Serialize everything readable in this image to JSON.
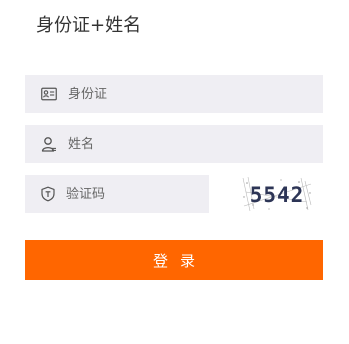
{
  "header": {
    "title": "身份证+姓名"
  },
  "form": {
    "id_field": {
      "placeholder": "身份证",
      "icon": "id-card-icon"
    },
    "name_field": {
      "placeholder": "姓名",
      "icon": "user-icon"
    },
    "code_field": {
      "placeholder": "验证码",
      "icon": "shield-icon"
    },
    "captcha": {
      "text": "5542"
    },
    "login_label": "登录"
  },
  "colors": {
    "accent": "#ff6600",
    "field_bg": "#efeef3",
    "text": "#333333",
    "placeholder": "#666666"
  }
}
